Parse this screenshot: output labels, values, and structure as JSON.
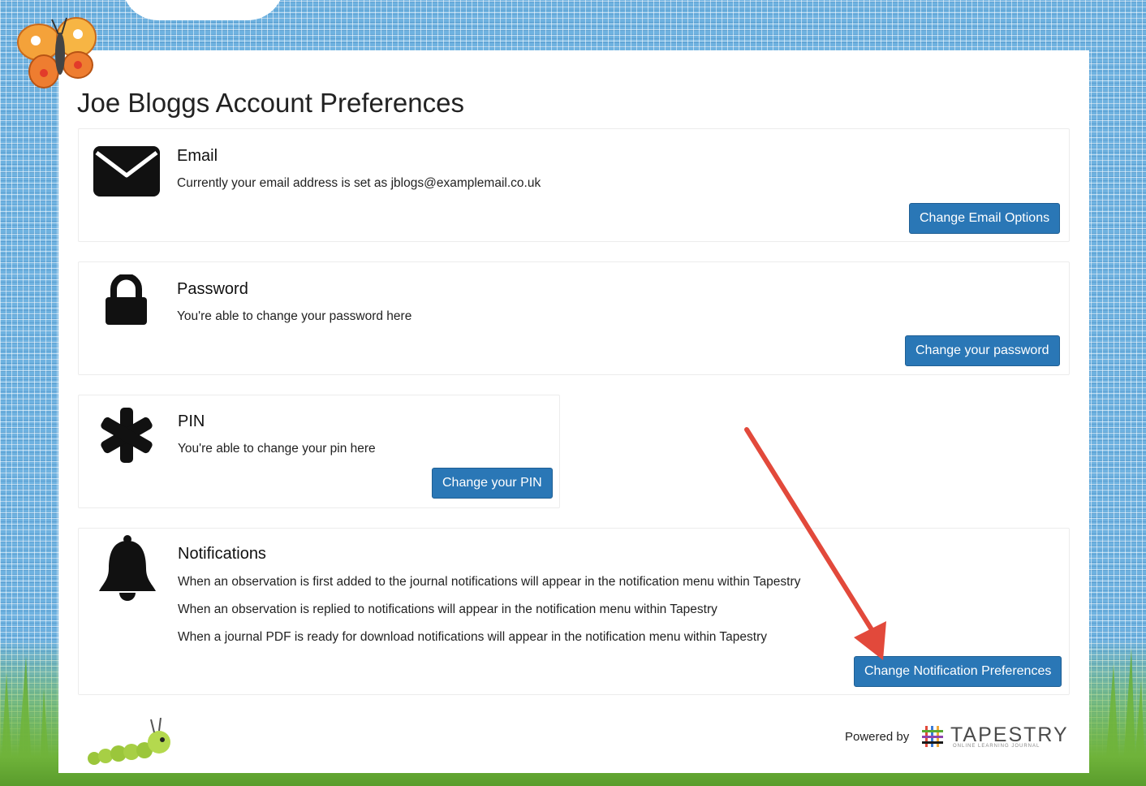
{
  "page": {
    "title": "Joe Bloggs Account Preferences"
  },
  "email": {
    "icon": "envelope-icon",
    "heading": "Email",
    "text": "Currently your email address is set as jblogs@examplemail.co.uk",
    "button": "Change Email Options"
  },
  "password": {
    "icon": "lock-icon",
    "heading": "Password",
    "text": "You're able to change your password here",
    "button": "Change your password"
  },
  "pin": {
    "icon": "asterisk-icon",
    "heading": "PIN",
    "text": "You're able to change your pin here",
    "button": "Change your PIN"
  },
  "notifications": {
    "icon": "bell-icon",
    "heading": "Notifications",
    "lines": [
      "When an observation is first added to the journal notifications will appear in the notification menu within Tapestry",
      "When an observation is replied to notifications will appear in the notification menu within Tapestry",
      "When a journal PDF is ready for download notifications will appear in the notification menu within Tapestry"
    ],
    "button": "Change Notification Preferences"
  },
  "footer": {
    "powered_by": "Powered by",
    "brand": "TAPESTRY",
    "tagline": "ONLINE LEARNING JOURNAL"
  },
  "colors": {
    "button": "#2a77b6",
    "arrow": "#e2493b",
    "border_sky": "#6fb2e0",
    "grass": "#6fb33a"
  }
}
